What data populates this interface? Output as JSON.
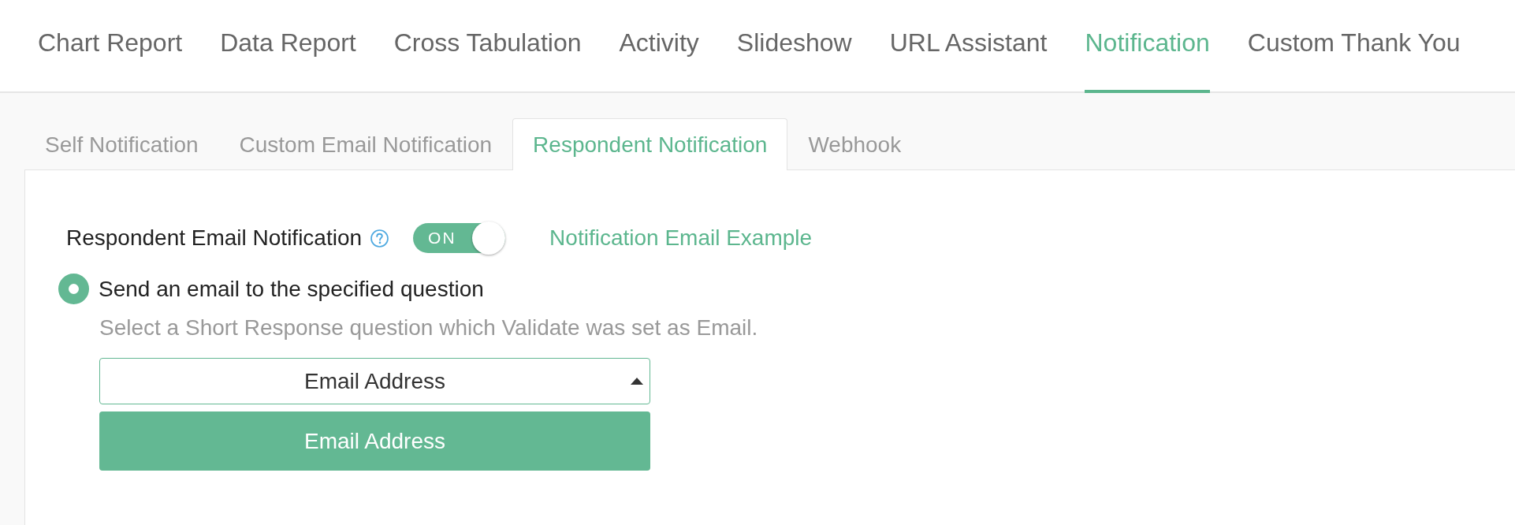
{
  "nav_tabs": [
    {
      "label": "Chart Report",
      "selected": false
    },
    {
      "label": "Data Report",
      "selected": false
    },
    {
      "label": "Cross Tabulation",
      "selected": false
    },
    {
      "label": "Activity",
      "selected": false
    },
    {
      "label": "Slideshow",
      "selected": false
    },
    {
      "label": "URL Assistant",
      "selected": false
    },
    {
      "label": "Notification",
      "selected": true
    },
    {
      "label": "Custom Thank You",
      "selected": false
    }
  ],
  "sub_tabs": [
    {
      "label": "Self Notification",
      "selected": false
    },
    {
      "label": "Custom Email Notification",
      "selected": false
    },
    {
      "label": "Respondent Notification",
      "selected": true
    },
    {
      "label": "Webhook",
      "selected": false
    }
  ],
  "respondent_notification": {
    "label": "Respondent Email Notification",
    "toggle": {
      "on": true,
      "text": "ON"
    },
    "example_link": "Notification Email Example"
  },
  "options": [
    {
      "label": "Send an email to the specified question",
      "selected": true,
      "hint": "Select a Short Response question which Validate was set as Email.",
      "select": {
        "value": "Email Address",
        "expanded": true,
        "options": [
          {
            "label": "Email Address",
            "selected": true
          }
        ]
      }
    }
  ]
}
